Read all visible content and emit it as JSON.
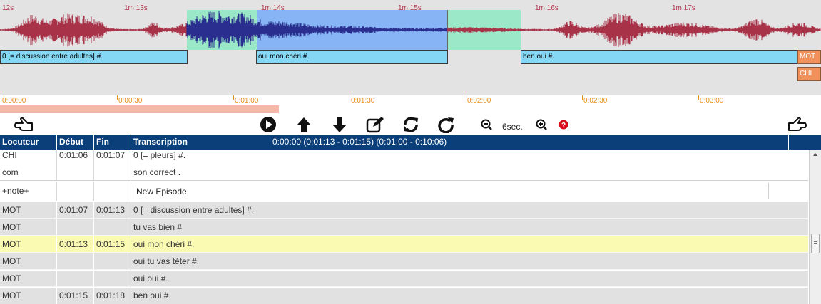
{
  "waveform": {
    "time_labels": [
      "12s",
      "1m 13s",
      "1m 14s",
      "1m 15s",
      "1m 16s",
      "1m 17s"
    ],
    "segments": [
      {
        "text": "0 [= discussion entre adultes]  #."
      },
      {
        "text": "oui mon chéri  #."
      },
      {
        "text": "ben oui  #."
      }
    ],
    "speakers": [
      "MOT",
      "CHI"
    ],
    "colors": {
      "waveform_red": "#a83248",
      "waveform_blue": "#2a2f8f",
      "highlight_blue": "#86b4f5",
      "highlight_green": "#9ae8c8",
      "segment": "#84d8f5",
      "speaker": "#f0905a"
    }
  },
  "timeline": {
    "labels": [
      "0:00:00",
      "0:00:30",
      "0:01:00",
      "0:01:30",
      "0:02:00",
      "0:02:30",
      "0:03:00"
    ],
    "progress": 0.34
  },
  "toolbar": {
    "zoom_label": "6sec.",
    "icons": [
      "hand-left-icon",
      "play-icon",
      "arrow-up-icon",
      "arrow-down-icon",
      "edit-icon",
      "refresh-icon",
      "redo-icon",
      "zoom-out-icon",
      "zoom-in-icon",
      "help-icon",
      "hand-right-icon"
    ]
  },
  "table": {
    "headers": {
      "speaker": "Locuteur",
      "start": "Début",
      "end": "Fin",
      "transcription": "Transcription"
    },
    "time_info": "0:00:00 (0:01:13 - 0:01:15)  (0:01:00 - 0:10:06)",
    "rows": [
      {
        "speaker": "CHI",
        "start": "0:01:06",
        "end": "0:01:07",
        "text": "0 [= pleurs] #."
      },
      {
        "speaker": " com",
        "start": "",
        "end": "",
        "text": "son correct ."
      },
      {
        "speaker": "+note+",
        "start": "",
        "end": "",
        "text": "New Episode"
      },
      {
        "speaker": "MOT",
        "start": "0:01:07",
        "end": "0:01:13",
        "text": "0 [= discussion entre adultes] #."
      },
      {
        "speaker": "MOT",
        "start": "",
        "end": "",
        "text": "tu vas bien #"
      },
      {
        "speaker": "MOT",
        "start": "0:01:13",
        "end": "0:01:15",
        "text": "oui mon chéri #."
      },
      {
        "speaker": "MOT",
        "start": "",
        "end": "",
        "text": "oui tu vas téter #."
      },
      {
        "speaker": "MOT",
        "start": "",
        "end": "",
        "text": "oui oui #."
      },
      {
        "speaker": "MOT",
        "start": "0:01:15",
        "end": "0:01:18",
        "text": "ben oui #."
      }
    ]
  }
}
